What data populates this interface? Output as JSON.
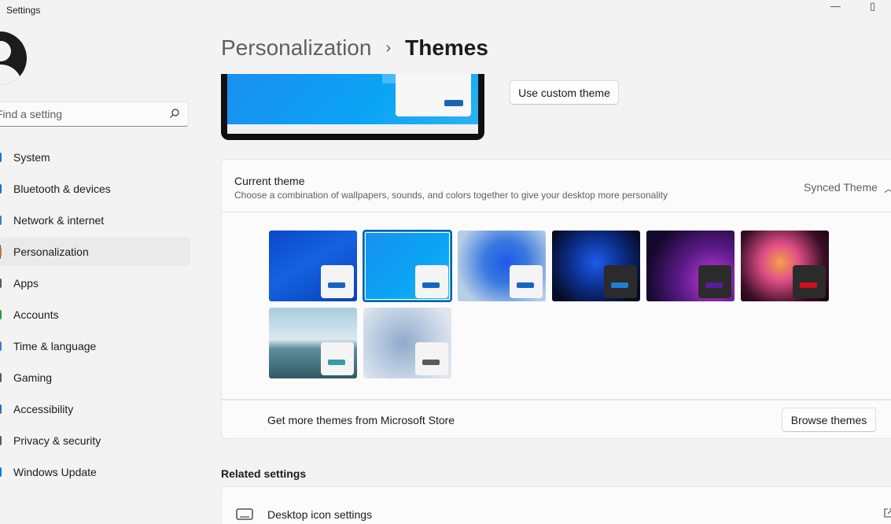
{
  "window": {
    "title": "Settings",
    "controls": [
      "—",
      "▯"
    ]
  },
  "search": {
    "placeholder": "Find a setting"
  },
  "sidebar": {
    "items": [
      {
        "label": "System",
        "icon": "system-icon",
        "color": "#0078d4",
        "selected": false
      },
      {
        "label": "Bluetooth & devices",
        "icon": "bluetooth-icon",
        "color": "#0078d4",
        "selected": false
      },
      {
        "label": "Network & internet",
        "icon": "network-icon",
        "color": "#3a7fc8",
        "selected": false
      },
      {
        "label": "Personalization",
        "icon": "personalization-icon",
        "color": "#c47a2c",
        "selected": true
      },
      {
        "label": "Apps",
        "icon": "apps-icon",
        "color": "#5a5a5a",
        "selected": false
      },
      {
        "label": "Accounts",
        "icon": "accounts-icon",
        "color": "#2c9a4b",
        "selected": false
      },
      {
        "label": "Time & language",
        "icon": "time-icon",
        "color": "#3a7fc8",
        "selected": false
      },
      {
        "label": "Gaming",
        "icon": "gaming-icon",
        "color": "#5a5a5a",
        "selected": false
      },
      {
        "label": "Accessibility",
        "icon": "accessibility-icon",
        "color": "#2b6fc0",
        "selected": false
      },
      {
        "label": "Privacy & security",
        "icon": "shield-icon",
        "color": "#5a5a5a",
        "selected": false
      },
      {
        "label": "Windows Update",
        "icon": "update-icon",
        "color": "#0078d4",
        "selected": false
      }
    ]
  },
  "breadcrumb": {
    "parent": "Personalization",
    "separator": "›",
    "current": "Themes"
  },
  "buttons": {
    "custom_theme": "Use custom theme",
    "browse_themes": "Browse themes"
  },
  "current_theme": {
    "title": "Current theme",
    "description": "Choose a combination of wallpapers, sounds, and colors together to give your desktop more personality",
    "value": "Synced Theme"
  },
  "themes": [
    {
      "name": "windows-blue",
      "bg": "linear-gradient(150deg,#0b47c9 0%,#1462e0 45%,#0a3fb8 100%)",
      "mini_bg": "#f4f4f4",
      "bar": "#1565c0",
      "selected": false
    },
    {
      "name": "windows-light",
      "bg": "linear-gradient(135deg,#1a8fef 0%,#0aa5f5 60%,#29b6f6 100%)",
      "mini_bg": "#f4f4f4",
      "bar": "#1565c0",
      "selected": true
    },
    {
      "name": "glow",
      "bg": "radial-gradient(circle at 55% 45%,#1d5be8 0%,#3a79e0 35%,#b6cde6 80%)",
      "mini_bg": "#f4f4f4",
      "bar": "#1565c0",
      "selected": false
    },
    {
      "name": "captured-motion",
      "bg": "radial-gradient(circle at 50% 45%,#1d5be8 0%,#0c2e8a 45%,#050c24 85%)",
      "mini_bg": "#2b2b2b",
      "bar": "#1c7fd6",
      "selected": false
    },
    {
      "name": "sunrise",
      "bg": "radial-gradient(circle at 75% 70%,#c23cd8 0%,#5a1a88 40%,#14082a 80%)",
      "mini_bg": "#2b2b2b",
      "bar": "#5a1a9a",
      "selected": false
    },
    {
      "name": "flow",
      "bg": "radial-gradient(circle at 45% 45%,#f4a14a 0%,#e04e86 30%,#3b0f26 70%,#120208 100%)",
      "mini_bg": "#2b2b2b",
      "bar": "#d0101c",
      "selected": false
    },
    {
      "name": "lake",
      "bg": "linear-gradient(180deg,#a9cde0 0%,#dbe8ee 45%,#5f8e9c 58%,#2f5a66 100%)",
      "mini_bg": "#f4f4f4",
      "bar": "#3a9aa0",
      "selected": false
    },
    {
      "name": "bloom",
      "bg": "radial-gradient(circle at 45% 50%,#8faacb 0%,#b9cbe0 45%,#dfe6ee 85%)",
      "mini_bg": "#f4f4f4",
      "bar": "#555b62",
      "selected": false
    }
  ],
  "store": {
    "label": "Get more themes from Microsoft Store"
  },
  "related": {
    "heading": "Related settings",
    "desktop_icons": "Desktop icon settings"
  }
}
